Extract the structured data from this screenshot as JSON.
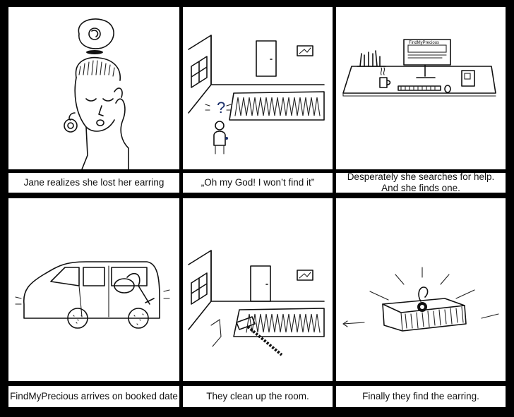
{
  "panels": [
    {
      "caption": "Jane realizes she lost her earring"
    },
    {
      "caption": "„Oh my God! I won’t find it”"
    },
    {
      "caption_line1": "Desperately she searches for help.",
      "caption_line2": "And she finds one."
    },
    {
      "caption": "FindMyPrecious arrives on booked date"
    },
    {
      "caption": "They clean up the room."
    },
    {
      "caption": "Finally they find the earring."
    }
  ],
  "monitor_text": "FindMyPrecious",
  "question_mark": "?"
}
